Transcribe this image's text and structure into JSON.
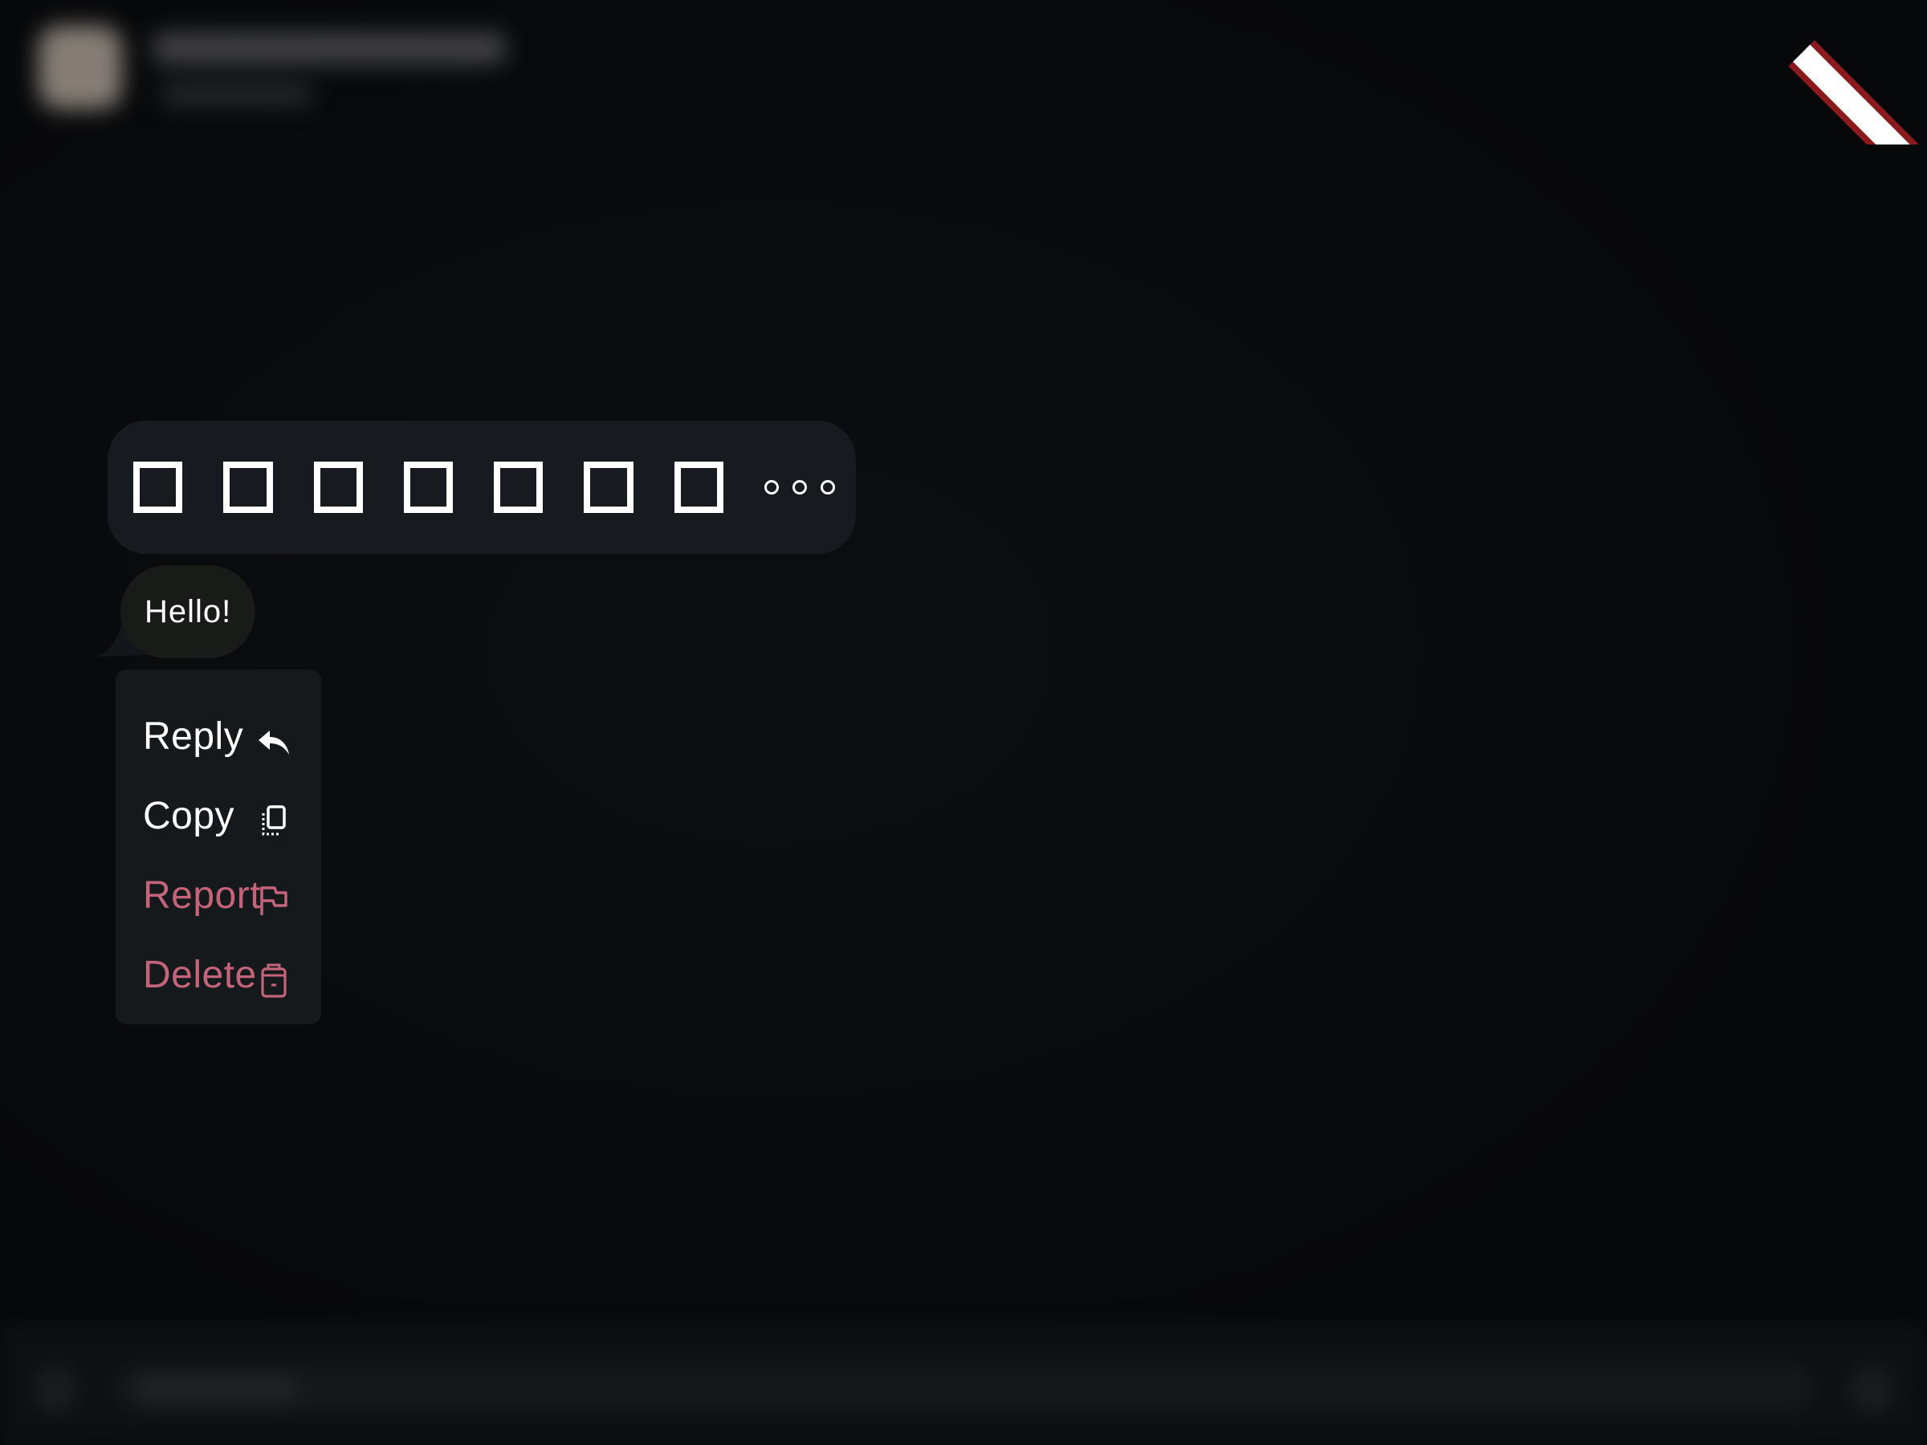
{
  "message": {
    "text": "Hello!"
  },
  "reactions": {
    "count": 7,
    "more_icon": "ellipsis-icon"
  },
  "context_menu": {
    "items": [
      {
        "label": "Reply",
        "icon": "reply-icon",
        "tone": "normal"
      },
      {
        "label": "Copy",
        "icon": "copy-icon",
        "tone": "normal"
      },
      {
        "label": "Report",
        "icon": "flag-icon",
        "tone": "danger"
      },
      {
        "label": "Delete",
        "icon": "trash-icon",
        "tone": "danger"
      }
    ]
  },
  "colors": {
    "background": "#07080a",
    "surface": "#171a1e",
    "bubble": "#181b17",
    "text": "#ffffff",
    "danger": "#c4647a",
    "debug_ribbon": "#8a1a1e"
  }
}
